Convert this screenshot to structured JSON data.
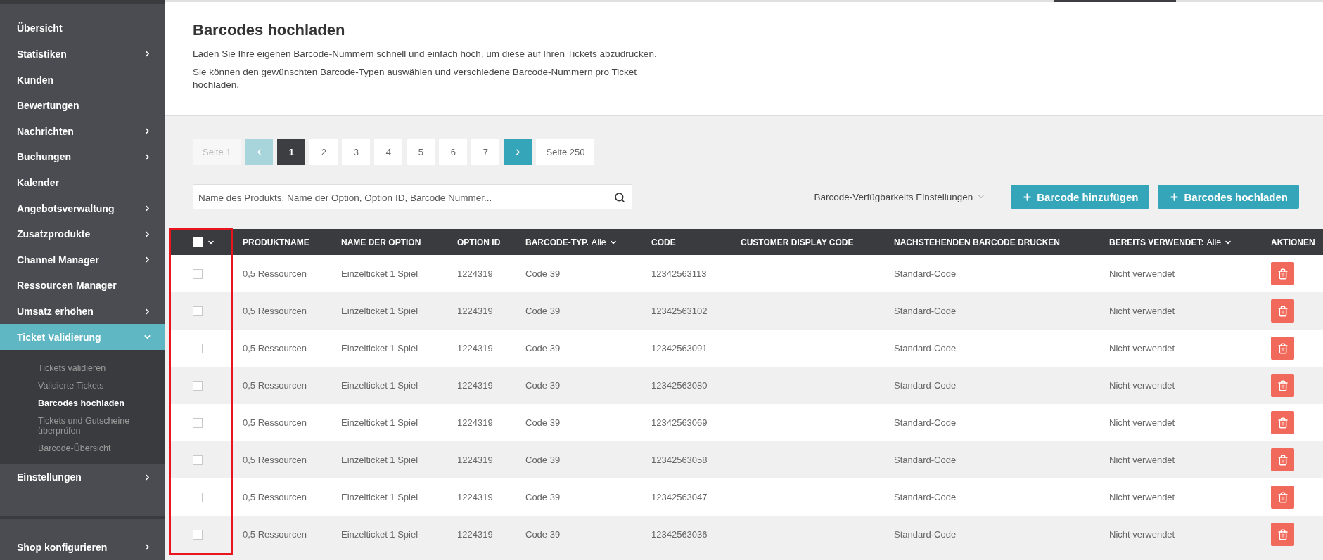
{
  "sidebar": {
    "items": [
      {
        "label": "Übersicht",
        "expandable": false,
        "expanded": false,
        "selected": false
      },
      {
        "label": "Statistiken",
        "expandable": true,
        "expanded": false,
        "selected": false
      },
      {
        "label": "Kunden",
        "expandable": false,
        "expanded": false,
        "selected": false
      },
      {
        "label": "Bewertungen",
        "expandable": false,
        "expanded": false,
        "selected": false
      },
      {
        "label": "Nachrichten",
        "expandable": true,
        "expanded": false,
        "selected": false
      },
      {
        "label": "Buchungen",
        "expandable": true,
        "expanded": false,
        "selected": false
      },
      {
        "label": "Kalender",
        "expandable": false,
        "expanded": false,
        "selected": false
      },
      {
        "label": "Angebotsverwaltung",
        "expandable": true,
        "expanded": false,
        "selected": false
      },
      {
        "label": "Zusatzprodukte",
        "expandable": true,
        "expanded": false,
        "selected": false
      },
      {
        "label": "Channel Manager",
        "expandable": true,
        "expanded": false,
        "selected": false
      },
      {
        "label": "Ressourcen Manager",
        "expandable": false,
        "expanded": false,
        "selected": false
      },
      {
        "label": "Umsatz erhöhen",
        "expandable": true,
        "expanded": false,
        "selected": false
      },
      {
        "label": "Ticket Validierung",
        "expandable": true,
        "expanded": true,
        "selected": true,
        "children": [
          {
            "label": "Tickets validieren",
            "selected": false
          },
          {
            "label": "Validierte Tickets",
            "selected": false
          },
          {
            "label": "Barcodes hochladen",
            "selected": true
          },
          {
            "label": "Tickets und Gutscheine überprüfen",
            "selected": false
          },
          {
            "label": "Barcode-Übersicht",
            "selected": false
          }
        ]
      },
      {
        "label": "Einstellungen",
        "expandable": true,
        "expanded": false,
        "selected": false
      }
    ],
    "footer_items": [
      {
        "label": "Shop konfigurieren",
        "expandable": true
      }
    ]
  },
  "header": {
    "title": "Barcodes hochladen",
    "paragraphs": [
      "Laden Sie Ihre eigenen Barcode-Nummern schnell und einfach hoch, um diese auf Ihren Tickets abzudrucken.",
      "Sie können den gewünschten Barcode-Typen auswählen und verschiedene Barcode-Nummern pro Ticket hochladen."
    ]
  },
  "pagination": [
    {
      "kind": "label",
      "text": "Seite 1",
      "disabled": true,
      "selected": false
    },
    {
      "kind": "prev",
      "disabled": true,
      "selected": false
    },
    {
      "kind": "page",
      "text": "1",
      "disabled": false,
      "selected": true
    },
    {
      "kind": "page",
      "text": "2",
      "disabled": false,
      "selected": false
    },
    {
      "kind": "page",
      "text": "3",
      "disabled": false,
      "selected": false
    },
    {
      "kind": "page",
      "text": "4",
      "disabled": false,
      "selected": false
    },
    {
      "kind": "page",
      "text": "5",
      "disabled": false,
      "selected": false
    },
    {
      "kind": "page",
      "text": "6",
      "disabled": false,
      "selected": false
    },
    {
      "kind": "page",
      "text": "7",
      "disabled": false,
      "selected": false
    },
    {
      "kind": "next",
      "disabled": false,
      "selected": false
    },
    {
      "kind": "label",
      "text": "Seite 250",
      "disabled": false,
      "selected": false
    }
  ],
  "search": {
    "placeholder": "Name des Produkts, Name der Option, Option ID, Barcode Nummer..."
  },
  "settings_dropdown": "Barcode-Verfügbarkeits Einstellungen",
  "buttons": [
    "Barcode hinzufügen",
    "Barcodes hochladen"
  ],
  "table": {
    "select_all_checked": false,
    "columns": [
      {
        "label": "PRODUKTNAME"
      },
      {
        "label": "NAME DER OPTION"
      },
      {
        "label": "OPTION ID"
      },
      {
        "label": "BARCODE-TYP.",
        "filter": "Alle"
      },
      {
        "label": "CODE"
      },
      {
        "label": "CUSTOMER DISPLAY CODE"
      },
      {
        "label": "NACHSTEHENDEN BARCODE DRUCKEN"
      },
      {
        "label": "BEREITS VERWENDET:",
        "filter": "Alle"
      },
      {
        "label": "AKTIONEN"
      }
    ],
    "rows": [
      {
        "checked": false,
        "cells": [
          "0,5 Ressourcen",
          "Einzelticket 1 Spiel",
          "1224319",
          "Code 39",
          "12342563113",
          "",
          "Standard-Code",
          "Nicht verwendet"
        ]
      },
      {
        "checked": false,
        "cells": [
          "0,5 Ressourcen",
          "Einzelticket 1 Spiel",
          "1224319",
          "Code 39",
          "12342563102",
          "",
          "Standard-Code",
          "Nicht verwendet"
        ]
      },
      {
        "checked": false,
        "cells": [
          "0,5 Ressourcen",
          "Einzelticket 1 Spiel",
          "1224319",
          "Code 39",
          "12342563091",
          "",
          "Standard-Code",
          "Nicht verwendet"
        ]
      },
      {
        "checked": false,
        "cells": [
          "0,5 Ressourcen",
          "Einzelticket 1 Spiel",
          "1224319",
          "Code 39",
          "12342563080",
          "",
          "Standard-Code",
          "Nicht verwendet"
        ]
      },
      {
        "checked": false,
        "cells": [
          "0,5 Ressourcen",
          "Einzelticket 1 Spiel",
          "1224319",
          "Code 39",
          "12342563069",
          "",
          "Standard-Code",
          "Nicht verwendet"
        ]
      },
      {
        "checked": false,
        "cells": [
          "0,5 Ressourcen",
          "Einzelticket 1 Spiel",
          "1224319",
          "Code 39",
          "12342563058",
          "",
          "Standard-Code",
          "Nicht verwendet"
        ]
      },
      {
        "checked": false,
        "cells": [
          "0,5 Ressourcen",
          "Einzelticket 1 Spiel",
          "1224319",
          "Code 39",
          "12342563047",
          "",
          "Standard-Code",
          "Nicht verwendet"
        ]
      },
      {
        "checked": false,
        "cells": [
          "0,5 Ressourcen",
          "Einzelticket 1 Spiel",
          "1224319",
          "Code 39",
          "12342563036",
          "",
          "Standard-Code",
          "Nicht verwendet"
        ]
      }
    ]
  }
}
